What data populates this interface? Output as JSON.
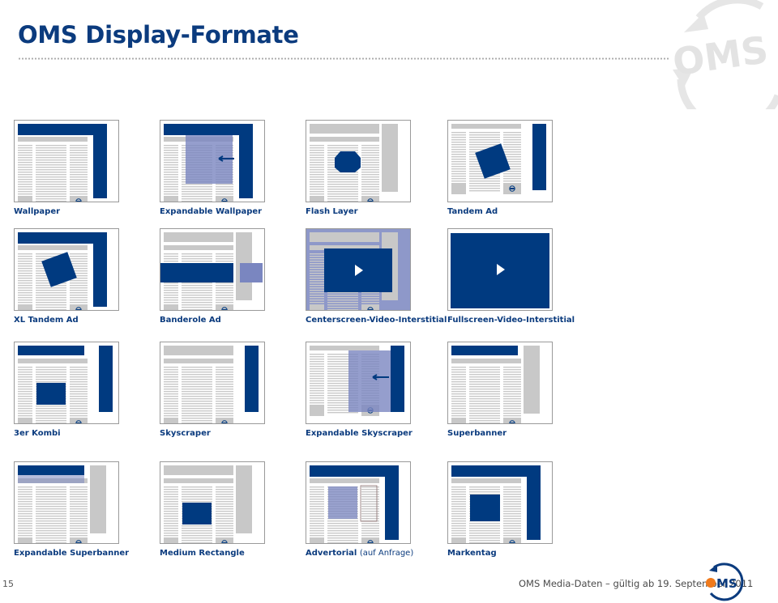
{
  "page": {
    "title": "OMS Display-Formate",
    "page_number": "15",
    "footer_text": "OMS Media-Daten – gültig ab 19. September 2011",
    "brand_logo_text": "OMS"
  },
  "colors": {
    "brand_blue": "#003a80",
    "expanded_blue": "#7a86c0",
    "grey_block": "#c8c8c8",
    "line_grey": "#c9c9c9",
    "accent_orange": "#f07a1c",
    "title_blue": "#0b3b7e"
  },
  "formats": [
    {
      "id": "wallpaper",
      "label": "Wallpaper",
      "label_note": "",
      "ads": [
        "wallpaper"
      ]
    },
    {
      "id": "expandable-wallpaper",
      "label": "Expandable Wallpaper",
      "label_note": "",
      "ads": [
        "wallpaper",
        "expand-overlay-wide"
      ]
    },
    {
      "id": "flash-layer",
      "label": "Flash Layer",
      "label_note": "",
      "ads": [
        "octagon-layer",
        "grey-skyscraper",
        "grey-header"
      ]
    },
    {
      "id": "tandem-ad",
      "label": "Tandem Ad",
      "label_note": "",
      "ads": [
        "skyscraper",
        "rotated-square"
      ]
    },
    {
      "id": "xl-tandem-ad",
      "label": "XL Tandem Ad",
      "label_note": "",
      "ads": [
        "wallpaper",
        "rotated-square"
      ]
    },
    {
      "id": "banderole-ad",
      "label": "Banderole Ad",
      "label_note": "",
      "ads": [
        "banderole",
        "grey-header",
        "grey-skyscraper"
      ]
    },
    {
      "id": "centerscreen-video-interstitial",
      "label": "Centerscreen-Video-Interstitial",
      "label_note": "",
      "ads": [
        "dim-page",
        "center-video",
        "grey-header",
        "grey-skyscraper"
      ]
    },
    {
      "id": "fullscreen-video-interstitial",
      "label": "Fullscreen-Video-Interstitial",
      "label_note": "",
      "ads": [
        "full-video"
      ]
    },
    {
      "id": "3er-kombi",
      "label": "3er Kombi",
      "label_note": "",
      "ads": [
        "banner-header",
        "skyscraper",
        "medium-rectangle"
      ]
    },
    {
      "id": "skyscraper",
      "label": "Skyscraper",
      "label_note": "",
      "ads": [
        "grey-header",
        "skyscraper"
      ]
    },
    {
      "id": "expandable-skyscraper",
      "label": "Expandable Skyscraper",
      "label_note": "",
      "ads": [
        "skyscraper",
        "expand-overlay-tall"
      ]
    },
    {
      "id": "superbanner",
      "label": "Superbanner",
      "label_note": "",
      "ads": [
        "banner-header",
        "grey-skyscraper"
      ]
    },
    {
      "id": "expandable-superbanner",
      "label": "Expandable Superbanner",
      "label_note": "",
      "ads": [
        "banner-header",
        "expand-banner",
        "grey-skyscraper"
      ]
    },
    {
      "id": "medium-rectangle",
      "label": "Medium Rectangle",
      "label_note": "",
      "ads": [
        "grey-header",
        "grey-skyscraper",
        "medium-rectangle"
      ]
    },
    {
      "id": "advertorial",
      "label": "Advertorial",
      "label_note": "(auf Anfrage)",
      "ads": [
        "wallpaper",
        "advertorial"
      ]
    },
    {
      "id": "markentag",
      "label": "Markentag",
      "label_note": "",
      "ads": [
        "wallpaper",
        "medium-rectangle-big"
      ]
    }
  ]
}
